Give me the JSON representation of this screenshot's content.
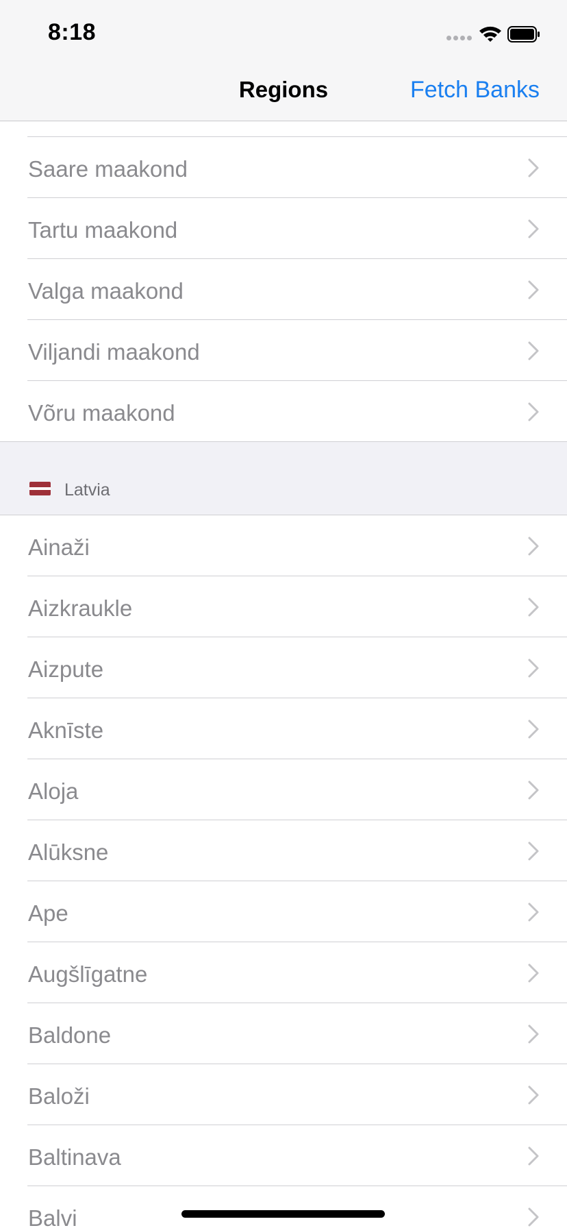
{
  "status_bar": {
    "time": "8:18",
    "icons": [
      "cellular-signal-icon",
      "wifi-icon",
      "battery-icon"
    ]
  },
  "nav": {
    "title": "Regions",
    "action_label": "Fetch Banks"
  },
  "estonia_partial": {
    "items": [
      "",
      "Saare maakond",
      "Tartu maakond",
      "Valga maakond",
      "Viljandi maakond",
      "Võru maakond"
    ]
  },
  "latvia": {
    "header": "Latvia",
    "flag_icon": "latvia-flag-icon",
    "items": [
      "Ainaži",
      "Aizkraukle",
      "Aizpute",
      "Aknīste",
      "Aloja",
      "Alūksne",
      "Ape",
      "Augšlīgatne",
      "Baldone",
      "Baloži",
      "Baltinava",
      "Balvi"
    ]
  },
  "colors": {
    "accent": "#1a7ff0",
    "row_text": "#8a8a8e",
    "section_bg": "#f1f1f6",
    "flag_red": "#9e3039"
  }
}
